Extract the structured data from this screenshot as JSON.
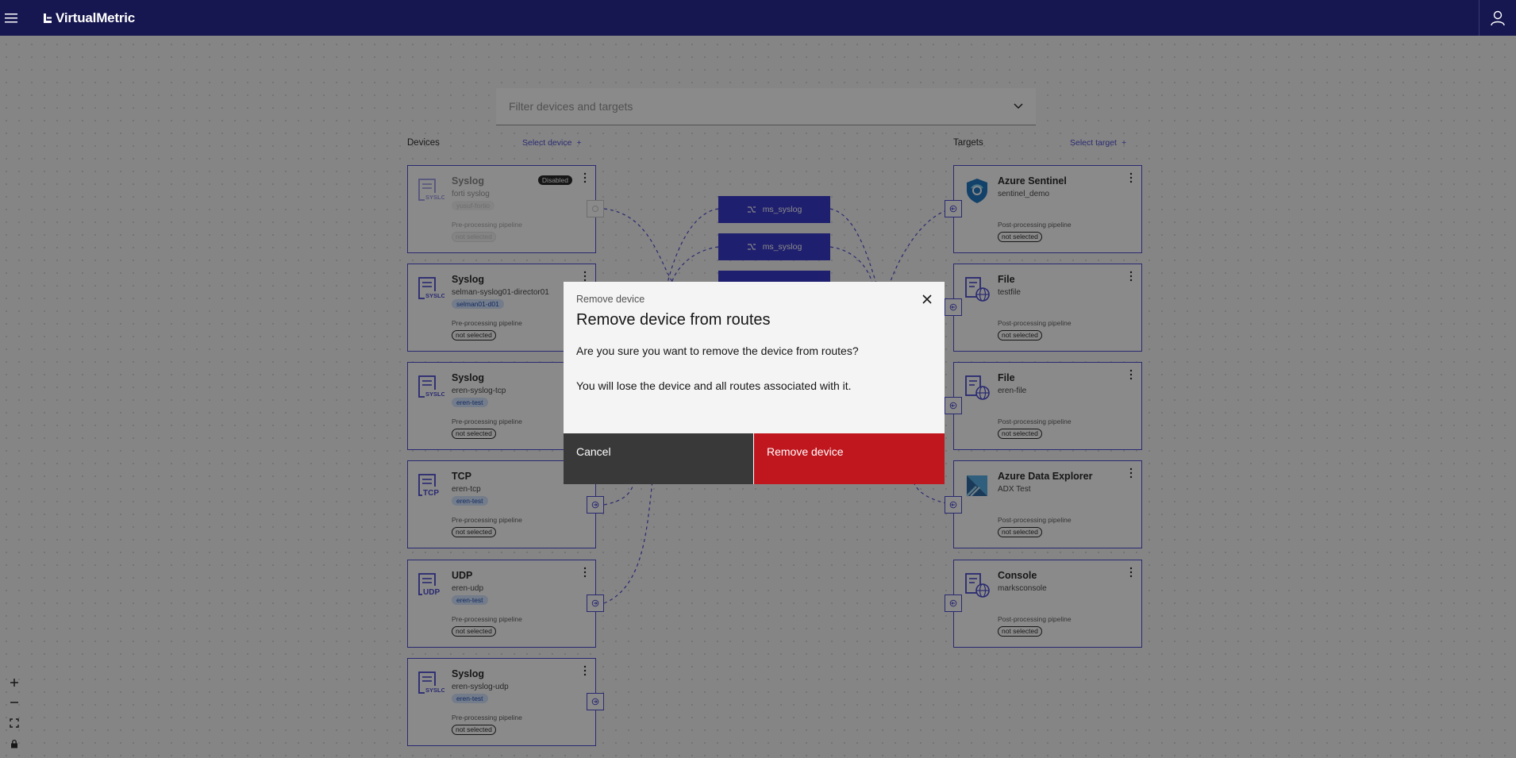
{
  "app": {
    "brand": "VirtualMetric",
    "menu_icon": "hamburger-menu-icon",
    "user_icon": "user-icon"
  },
  "filter": {
    "placeholder": "Filter devices and targets"
  },
  "devices": {
    "header": "Devices",
    "select_label": "Select device",
    "items": [
      {
        "type": "Syslog",
        "name": "forti syslog",
        "tag": "yusuf-fortio",
        "badge": "Disabled",
        "pipeline_label": "Pre-processing pipeline",
        "pipeline": "not selected"
      },
      {
        "type": "Syslog",
        "name": "selman-syslog01-director01",
        "tag": "selman01-d01",
        "pipeline_label": "Pre-processing pipeline",
        "pipeline": "not selected"
      },
      {
        "type": "Syslog",
        "name": "eren-syslog-tcp",
        "tag": "eren-test",
        "pipeline_label": "Pre-processing pipeline",
        "pipeline": "not selected"
      },
      {
        "type": "TCP",
        "name": "eren-tcp",
        "tag": "eren-test",
        "pipeline_label": "Pre-processing pipeline",
        "pipeline": "not selected"
      },
      {
        "type": "UDP",
        "name": "eren-udp",
        "tag": "eren-test",
        "pipeline_label": "Pre-processing pipeline",
        "pipeline": "not selected"
      },
      {
        "type": "Syslog",
        "name": "eren-syslog-udp",
        "tag": "eren-test",
        "pipeline_label": "Pre-processing pipeline",
        "pipeline": "not selected"
      }
    ]
  },
  "targets": {
    "header": "Targets",
    "select_label": "Select target",
    "items": [
      {
        "type": "Azure Sentinel",
        "name": "sentinel_demo",
        "pipeline_label": "Post-processing pipeline",
        "pipeline": "not selected"
      },
      {
        "type": "File",
        "name": "testfile",
        "pipeline_label": "Post-processing pipeline",
        "pipeline": "not selected"
      },
      {
        "type": "File",
        "name": "eren-file",
        "pipeline_label": "Post-processing pipeline",
        "pipeline": "not selected"
      },
      {
        "type": "Azure Data Explorer",
        "name": "ADX Test",
        "pipeline_label": "Post-processing pipeline",
        "pipeline": "not selected"
      },
      {
        "type": "Console",
        "name": "marksconsole",
        "pipeline_label": "Post-processing pipeline",
        "pipeline": "not selected"
      }
    ]
  },
  "routes": [
    {
      "label": "ms_syslog"
    },
    {
      "label": "ms_syslog"
    }
  ],
  "icon_labels": {
    "syslog": "SYSLOG",
    "tcp": "TCP",
    "udp": "UDP"
  },
  "modal": {
    "label": "Remove device",
    "heading": "Remove device from routes",
    "message1": "Are you sure you want to remove the device from routes?",
    "message2": "You will lose the device and all routes associated with it.",
    "cancel": "Cancel",
    "confirm": "Remove device"
  },
  "colors": {
    "header_bg": "#161650",
    "accent": "#3d3dcf",
    "route_bg": "#2828c8",
    "danger": "#c0171f",
    "secondary_btn": "#393939"
  }
}
